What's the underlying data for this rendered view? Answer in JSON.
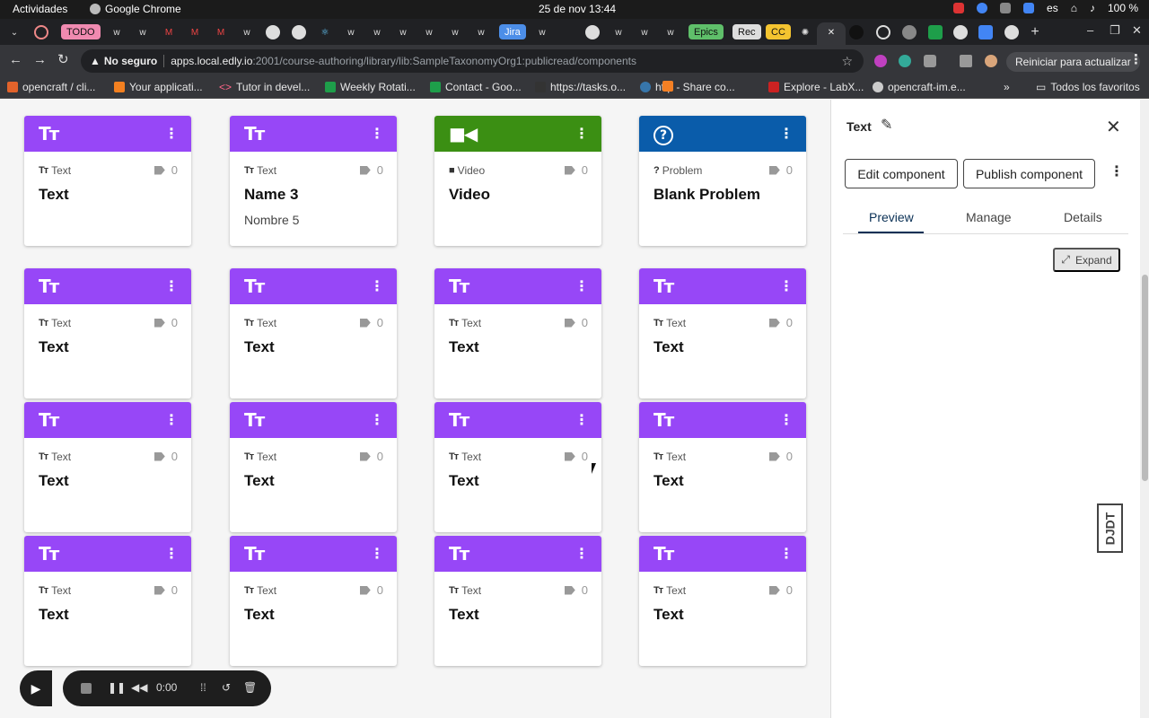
{
  "system_bar": {
    "activities": "Actividades",
    "app_name": "Google Chrome",
    "clock": "25 de nov  13:44",
    "language": "es",
    "battery": "100 %"
  },
  "tabs": {
    "todo_label": "TODO",
    "jira_label": "Jira",
    "epics_label": "Epics",
    "rec_label": "Rec",
    "cc_label": "CC",
    "new_tab_symbol": "+",
    "close_symbol": "✕"
  },
  "toolbar": {
    "security_label": "No seguro",
    "url_host": "apps.local.edly.io",
    "url_path": ":2001/course-authoring/library/lib:SampleTaxonomyOrg1:publicread/components",
    "update_button": "Reiniciar para actualizar"
  },
  "bookmarks": {
    "items": [
      "opencraft / cli...",
      "Your applicati...",
      "Tutor in devel...",
      "Weekly Rotati...",
      "Contact - Goo...",
      "https://tasks.o...",
      "http - Share co...",
      "Explore - LabX...",
      "opencraft-im.e..."
    ],
    "more": "»",
    "all_favorites": "Todos los favoritos"
  },
  "colors": {
    "text_header": "#9747f7",
    "video_header": "#3b8f13",
    "problem_header": "#0a5caa",
    "accent_dark": "#0a3055"
  },
  "cards": [
    {
      "kind": "Text",
      "icon": "text-type-icon",
      "tags": "0",
      "title": "Text",
      "subtitle": ""
    },
    {
      "kind": "Text",
      "icon": "text-type-icon",
      "tags": "0",
      "title": "Name 3",
      "subtitle": "Nombre 5"
    },
    {
      "kind": "Video",
      "icon": "video-camera-icon",
      "tags": "0",
      "title": "Video",
      "subtitle": ""
    },
    {
      "kind": "Problem",
      "icon": "question-circle-icon",
      "tags": "0",
      "title": "Blank Problem",
      "subtitle": ""
    },
    {
      "kind": "Text",
      "icon": "text-type-icon",
      "tags": "0",
      "title": "Text",
      "subtitle": ""
    },
    {
      "kind": "Text",
      "icon": "text-type-icon",
      "tags": "0",
      "title": "Text",
      "subtitle": ""
    },
    {
      "kind": "Text",
      "icon": "text-type-icon",
      "tags": "0",
      "title": "Text",
      "subtitle": ""
    },
    {
      "kind": "Text",
      "icon": "text-type-icon",
      "tags": "0",
      "title": "Text",
      "subtitle": ""
    },
    {
      "kind": "Text",
      "icon": "text-type-icon",
      "tags": "0",
      "title": "Text",
      "subtitle": ""
    },
    {
      "kind": "Text",
      "icon": "text-type-icon",
      "tags": "0",
      "title": "Text",
      "subtitle": ""
    },
    {
      "kind": "Text",
      "icon": "text-type-icon",
      "tags": "0",
      "title": "Text",
      "subtitle": ""
    },
    {
      "kind": "Text",
      "icon": "text-type-icon",
      "tags": "0",
      "title": "Text",
      "subtitle": ""
    },
    {
      "kind": "Text",
      "icon": "text-type-icon",
      "tags": "0",
      "title": "Text",
      "subtitle": ""
    },
    {
      "kind": "Text",
      "icon": "text-type-icon",
      "tags": "0",
      "title": "Text",
      "subtitle": ""
    },
    {
      "kind": "Text",
      "icon": "text-type-icon",
      "tags": "0",
      "title": "Text",
      "subtitle": ""
    },
    {
      "kind": "Text",
      "icon": "text-type-icon",
      "tags": "0",
      "title": "Text",
      "subtitle": ""
    }
  ],
  "side_panel": {
    "title": "Text",
    "edit_button": "Edit component",
    "publish_button": "Publish component",
    "tabs": [
      "Preview",
      "Manage",
      "Details"
    ],
    "active_tab": "Preview",
    "expand_button": "Expand",
    "debug_toolbar_label": "DJDT"
  },
  "recorder": {
    "time": "0:00"
  }
}
